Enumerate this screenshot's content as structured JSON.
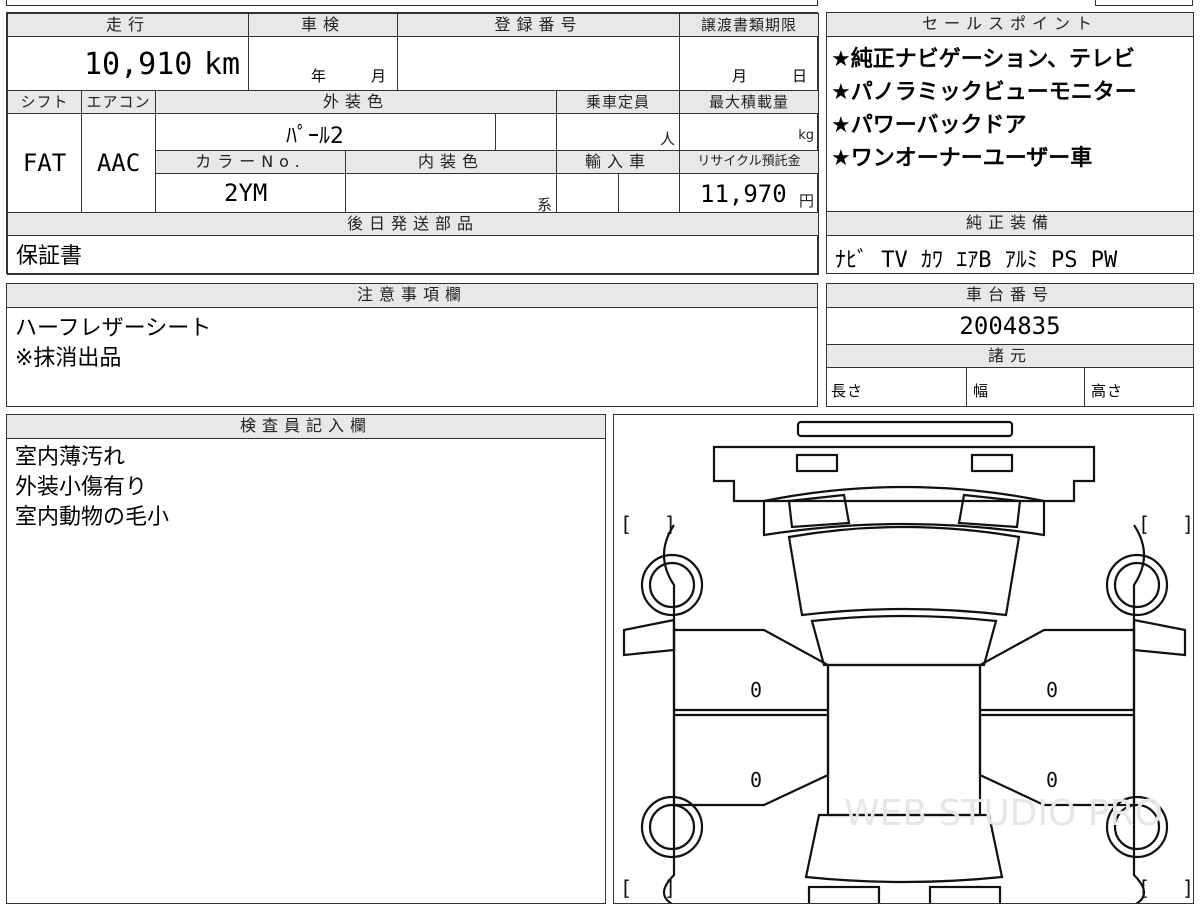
{
  "mileage": {
    "label": "走行",
    "value": "10,910",
    "unit": "km"
  },
  "inspection": {
    "label": "車検",
    "year_label": "年",
    "month_label": "月",
    "year": "",
    "month": ""
  },
  "registration": {
    "label": "登録番号",
    "value": ""
  },
  "transfer_deadline": {
    "label": "譲渡書類期限",
    "month_label": "月",
    "day_label": "日"
  },
  "shift": {
    "label": "シフト",
    "value": "FAT"
  },
  "aircon": {
    "label": "エアコン",
    "value": "AAC"
  },
  "exterior_color": {
    "label": "外装色",
    "value": "ﾊﾟｰﾙ2"
  },
  "capacity": {
    "label": "乗車定員",
    "unit": "人",
    "value": ""
  },
  "max_load": {
    "label": "最大積載量",
    "unit": "kg",
    "value": ""
  },
  "color_no": {
    "label": "カラーNo.",
    "value": "2YM"
  },
  "interior_color": {
    "label": "内装色",
    "suffix": "系",
    "value": ""
  },
  "import": {
    "label": "輸入車",
    "value": ""
  },
  "recycle_fee": {
    "label": "リサイクル預託金",
    "value": "11,970",
    "unit": "円"
  },
  "later_parts": {
    "label": "後日発送部品",
    "value": "保証書"
  },
  "sales_points": {
    "label": "セールスポイント",
    "items": [
      "★純正ナビゲーション、テレビ",
      "★パノラミックビューモニター",
      "★パワーバックドア",
      "★ワンオーナーユーザー車"
    ]
  },
  "factory_equipment": {
    "label": "純正装備",
    "value": "ﾅﾋﾞ TV ｶﾜ ｴｱB ｱﾙﾐ PS PW"
  },
  "notes": {
    "label": "注意事項欄",
    "lines": [
      "ハーフレザーシート",
      "※抹消出品"
    ]
  },
  "chassis_no": {
    "label": "車台番号",
    "value": "2004835"
  },
  "specs": {
    "label": "諸元",
    "length": "長さ",
    "width": "幅",
    "height": "高さ"
  },
  "inspector": {
    "label": "検査員記入欄",
    "lines": [
      "室内薄汚れ",
      "外装小傷有り",
      "室内動物の毛小"
    ]
  },
  "diagram": {
    "bracket_open": "[",
    "bracket_close": "]",
    "zero": "0",
    "watermark": "WEB STUDIO PRO"
  }
}
